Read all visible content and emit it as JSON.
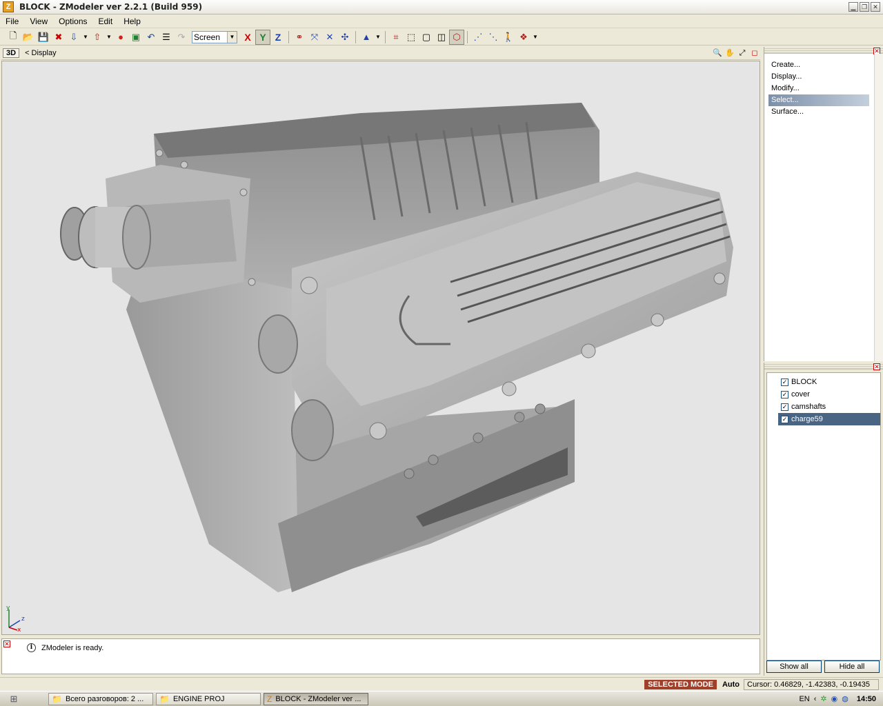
{
  "window": {
    "title": "BLOCK - ZModeler ver 2.2.1 (Build 959)",
    "icon": "Z"
  },
  "menu": [
    {
      "label": "File"
    },
    {
      "label": "View"
    },
    {
      "label": "Options"
    },
    {
      "label": "Edit"
    },
    {
      "label": "Help"
    }
  ],
  "toolbar": {
    "coord_mode": "Screen",
    "axis_x": "X",
    "axis_y": "Y",
    "axis_z": "Z"
  },
  "viewport": {
    "mode_label": "3D",
    "title": "<  Display",
    "axis_labels": {
      "y": "y",
      "z": "z",
      "x": "x"
    }
  },
  "commands": [
    {
      "label": "Create..."
    },
    {
      "label": "Display..."
    },
    {
      "label": "Modify..."
    },
    {
      "label": "Select..."
    },
    {
      "label": "Surface..."
    }
  ],
  "objects": [
    {
      "name": "BLOCK",
      "checked": true
    },
    {
      "name": "cover",
      "checked": true
    },
    {
      "name": "camshafts",
      "checked": true
    },
    {
      "name": "charge59",
      "checked": true
    }
  ],
  "object_buttons": {
    "show_all": "Show all",
    "hide_all": "Hide all"
  },
  "log": {
    "message": "ZModeler is ready."
  },
  "status": {
    "mode": "SELECTED MODE",
    "snap": "Auto",
    "cursor": "Cursor: 0.46829, -1.42383, -0.19435"
  },
  "taskbar": {
    "tasks": [
      {
        "label": "Всего разговоров: 2 ..."
      },
      {
        "label": "ENGINE PROJ"
      },
      {
        "label": "BLOCK - ZModeler ver ..."
      }
    ],
    "lang": "EN",
    "clock": "14:50"
  },
  "colors": {
    "mode_badge": "#a0402a",
    "selection": "#4a6584",
    "viewport_bg": "#e5e5e5"
  }
}
